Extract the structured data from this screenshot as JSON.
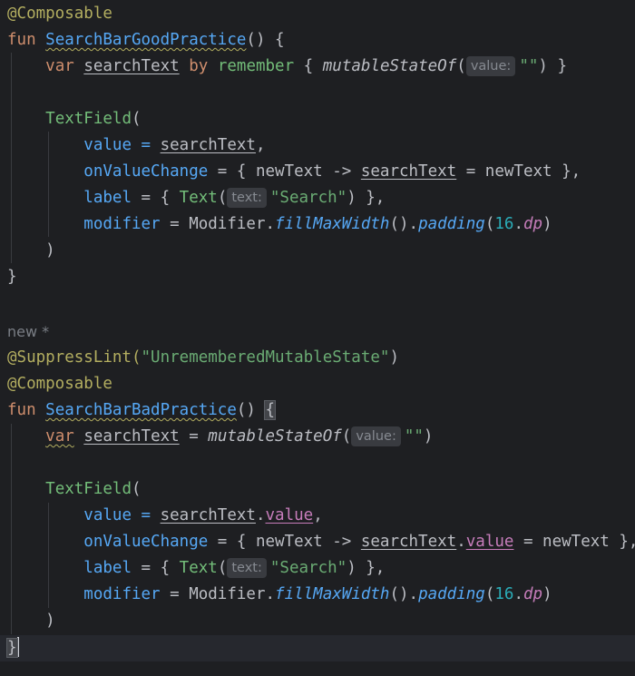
{
  "code": {
    "good": {
      "annotation": "@Composable",
      "fun_keyword": "fun",
      "fun_name": "SearchBarGoodPractice",
      "fun_tail": "() {",
      "var_keyword": "var",
      "var_name": "searchText",
      "by_keyword": "by",
      "remember": "remember",
      "brace_open": " { ",
      "mutable_fn": "mutableStateOf",
      "paren_open": "(",
      "hint_value": "value:",
      "empty_string": "\"\"",
      "tail": ") }",
      "textfield": "TextField",
      "textfield_paren": "(",
      "value_param": "value",
      "eq": " = ",
      "comma": ",",
      "onchange_param": "onValueChange",
      "lambda_open": " = { newText -> ",
      "assign": " = newText },",
      "label_param": "label",
      "label_mid": " = { ",
      "text_fn": "Text",
      "hint_text": "text:",
      "search_string": "\"Search\"",
      "label_tail": ") },",
      "modifier_param": "modifier",
      "modifier_obj": "Modifier.",
      "fill_fn": "fillMaxWidth",
      "call_dot": "().",
      "padding_fn": "padding",
      "num16": "16",
      "dot": ".",
      "dp": "dp",
      "close_paren": ")",
      "close_brace": "}"
    },
    "author_label": "new *",
    "bad": {
      "suppress_annotation": "@SuppressLint(",
      "suppress_string": "\"UnrememberedMutableState\"",
      "suppress_tail": ")",
      "annotation": "@Composable",
      "fun_keyword": "fun",
      "fun_name": "SearchBarBadPractice",
      "fun_paren": "() ",
      "fun_brace": "{",
      "var_keyword": "var",
      "var_name": "searchText",
      "eq": " = ",
      "mutable_fn": "mutableStateOf",
      "hint_value": "value:",
      "empty_string": "\"\"",
      "value_prop": "value",
      "close_brace": "}"
    }
  },
  "colors": {
    "background": "#1e1f22",
    "keyword": "#cf8e6d",
    "annotation": "#b3ae60",
    "function": "#56a8f5",
    "string": "#6aab73",
    "property": "#c77dbb",
    "number": "#2aacb8",
    "composable_call": "#73bd79"
  }
}
